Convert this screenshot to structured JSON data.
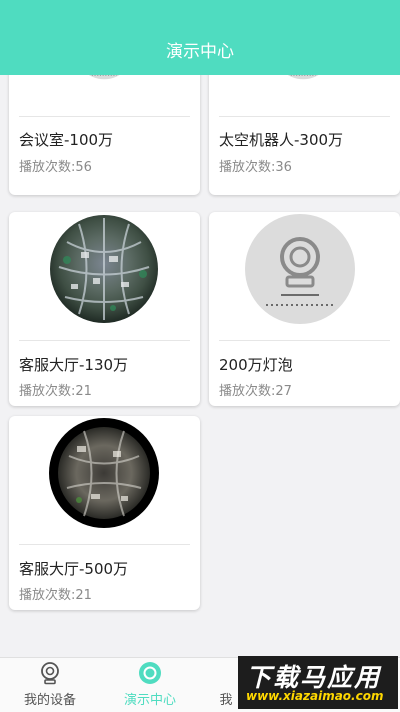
{
  "header": {
    "title": "演示中心"
  },
  "cards": [
    {
      "title": "会议室-100万",
      "plays": "播放次数:56",
      "thumb": "camera-placeholder"
    },
    {
      "title": "太空机器人-300万",
      "plays": "播放次数:36",
      "thumb": "camera-placeholder"
    },
    {
      "title": "客服大厅-130万",
      "plays": "播放次数:21",
      "thumb": "fisheye-office-photo"
    },
    {
      "title": "200万灯泡",
      "plays": "播放次数:27",
      "thumb": "camera-placeholder"
    },
    {
      "title": "客服大厅-500万",
      "plays": "播放次数:21",
      "thumb": "fisheye-office-photo"
    }
  ],
  "tabs": [
    {
      "label": "我的设备",
      "icon": "camera-icon",
      "active": false
    },
    {
      "label": "演示中心",
      "icon": "play-circle-icon",
      "active": true
    },
    {
      "label": "我",
      "icon": "user-icon",
      "active": false
    }
  ],
  "watermark": {
    "main": "下载马应用",
    "sub": "www.xiazaimao.com"
  },
  "colors": {
    "accent": "#4fdcc0",
    "inactive_tab": "#555555",
    "placeholder_circle": "#dcdcdc"
  }
}
